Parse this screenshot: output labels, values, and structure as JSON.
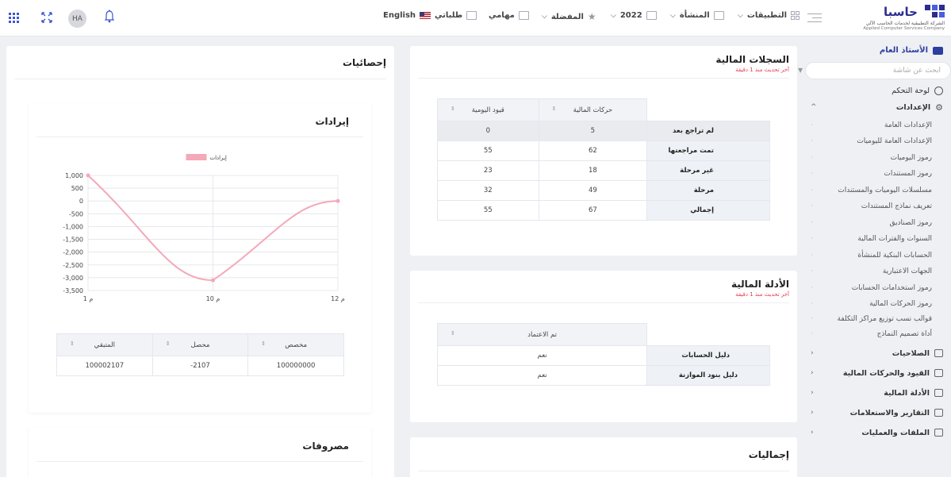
{
  "header": {
    "language": "English",
    "my_requests": "طلباتي",
    "my_tasks": "مهامي",
    "favorites": "المفضلة",
    "year": "2022",
    "facility": "المنشأة",
    "applications": "التطبيقات",
    "user_initials": "HA",
    "logo_text": "حاسبا",
    "logo_sub_ar": "الشركة التطبيقية لخدمات الحاسب الآلي",
    "logo_sub_en": "Applied Computer Services Company",
    "flag_color": "#b22234"
  },
  "sidebar": {
    "title": "الأستاذ العام",
    "search_placeholder": "ابحث عن شاشة",
    "dashboard": "لوحة التحكم",
    "settings": "الإعدادات",
    "settings_items": [
      "الإعدادات العامة",
      "الإعدادات العامة لليوميات",
      "رموز اليوميات",
      "رموز المستندات",
      "مسلسلات اليوميات والمستندات",
      "تعريف نماذج المستندات",
      "رموز الصناديق",
      "السنوات والفترات المالية",
      "الحسابات البنكية للمنشأة",
      "الجهات الاعتبارية",
      "رموز استخدامات الحسابات",
      "رموز الحركات المالية",
      "قوالب نسب توزيع مراكز التكلفة",
      "أداة تصميم النماذج"
    ],
    "sections": [
      "الصلاحيات",
      "القيود والحركات المالية",
      "الأدلة المالية",
      "التقارير والاستعلامات",
      "الملفات والعمليات"
    ]
  },
  "financial_records": {
    "title": "السجلات المالية",
    "updated": "آخر تحديث منذ 1 دقيقة",
    "columns": [
      "حركات المالية",
      "قيود اليومية"
    ],
    "rows": [
      {
        "label": "لم تراجع بعد",
        "movements": "5",
        "journal": "0"
      },
      {
        "label": "تمت مراجعتها",
        "movements": "62",
        "journal": "55"
      },
      {
        "label": "غير مرحلة",
        "movements": "18",
        "journal": "23"
      },
      {
        "label": "مرحلة",
        "movements": "49",
        "journal": "32"
      },
      {
        "label": "إجمالي",
        "movements": "67",
        "journal": "55"
      }
    ]
  },
  "financial_guides": {
    "title": "الأدلة المالية",
    "updated": "آخر تحديث منذ 1 دقيقة",
    "column": "تم الاعتماد",
    "rows": [
      {
        "label": "دليل الحسابات",
        "value": "نعم"
      },
      {
        "label": "دليل بنود الموازنة",
        "value": "نعم"
      }
    ]
  },
  "totals": {
    "title": "إجماليات"
  },
  "statistics": {
    "title": "إحصائيات",
    "revenues": {
      "title": "إيرادات",
      "summary_columns": [
        "مخصص",
        "محصل",
        "المتبقي"
      ],
      "summary_values": [
        "100000000",
        "-2107",
        "100002107"
      ]
    },
    "expenses": {
      "title": "مصروفات"
    }
  },
  "chart_data": {
    "type": "line",
    "x": [
      "م 1",
      "م 10",
      "م 12"
    ],
    "series": [
      {
        "name": "إيرادات",
        "values": [
          1000,
          -3100,
          0
        ],
        "color": "#f4a8b8"
      }
    ],
    "yticks": [
      "1,000",
      "500",
      "0",
      "-500",
      "-1,000",
      "-1,500",
      "-2,000",
      "-2,500",
      "-3,000",
      "-3,500"
    ],
    "ylim": [
      -3500,
      1000
    ],
    "grid": true,
    "legend": "top"
  }
}
